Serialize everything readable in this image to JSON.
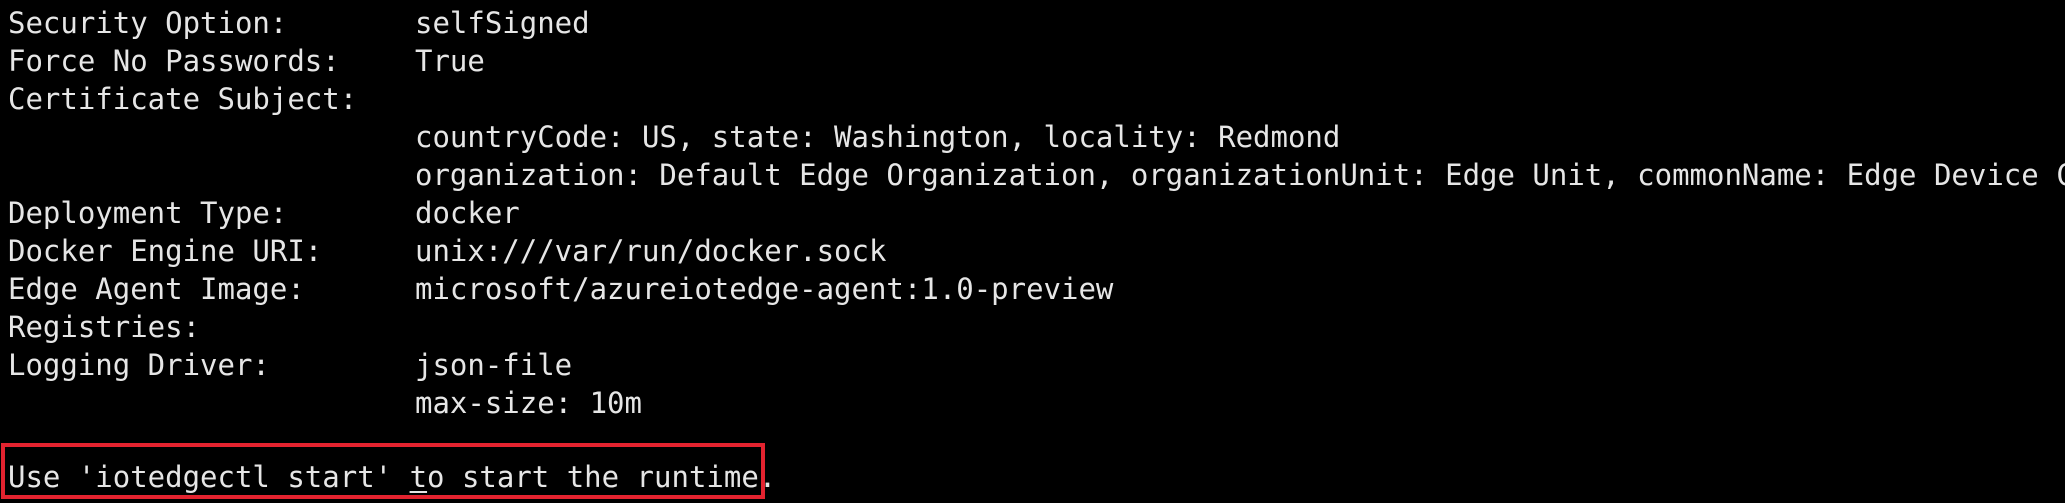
{
  "colors": {
    "background": "#000000",
    "text": "#e6e6e6",
    "highlight_border": "#e3232f"
  },
  "config": {
    "security_option": {
      "label": "Security Option:",
      "value": "selfSigned"
    },
    "force_no_passwords": {
      "label": "Force No Passwords:",
      "value": "True"
    },
    "certificate_subject": {
      "label": "Certificate Subject:",
      "line1": "countryCode: US, state: Washington, locality: Redmond",
      "line2": "organization: Default Edge Organization, organizationUnit: Edge Unit, commonName: Edge Device CA"
    },
    "deployment_type": {
      "label": "Deployment Type:",
      "value": "docker"
    },
    "docker_engine_uri": {
      "label": "Docker Engine URI:",
      "value": "unix:///var/run/docker.sock"
    },
    "edge_agent_image": {
      "label": "Edge Agent Image:",
      "value": "microsoft/azureiotedge-agent:1.0-preview"
    },
    "registries": {
      "label": "Registries:"
    },
    "logging_driver": {
      "label": "Logging Driver:",
      "value": "json-file",
      "option": "max-size: 10m"
    }
  },
  "hint": {
    "before": "Use 'iotedgectl start' ",
    "cursor": "t",
    "after": "o start the runtime."
  }
}
